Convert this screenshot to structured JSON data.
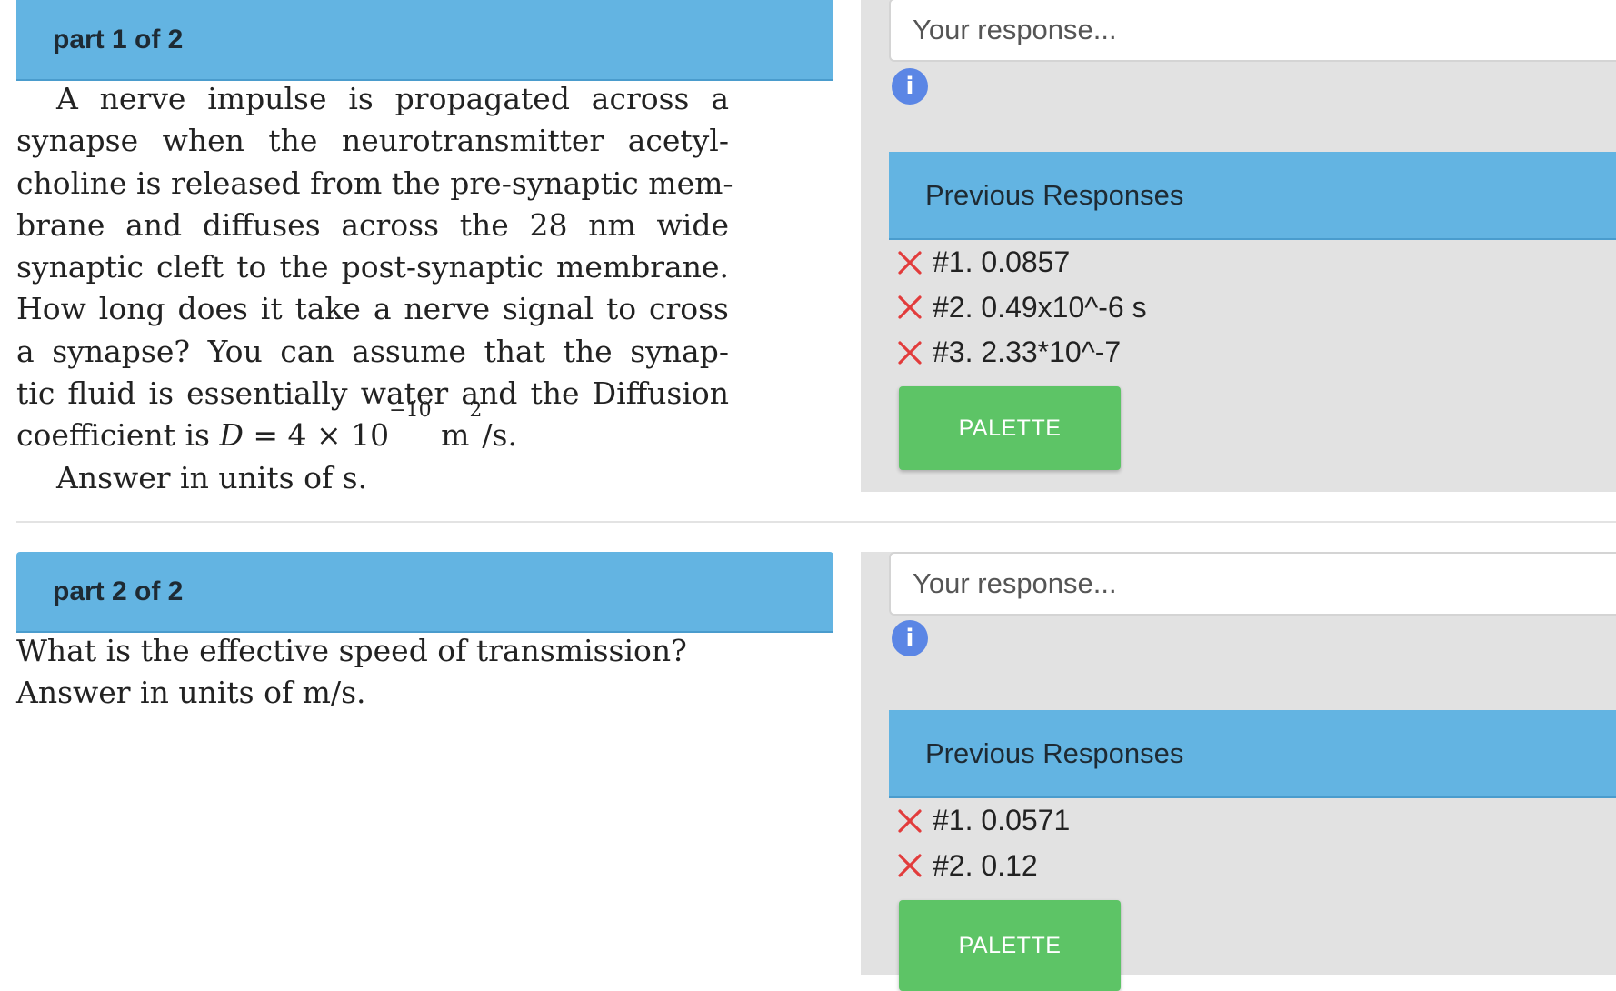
{
  "parts": [
    {
      "label": "part 1 of 2",
      "question": {
        "line1": "A nerve impulse is propagated across a",
        "line2": "synapse when the neurotransmitter acetyl-",
        "line3": "choline is released from the pre-synaptic mem-",
        "line4": "brane and diffuses across the 28 nm wide",
        "line5": "synaptic cleft to the post-synaptic membrane.",
        "line6": "How long does it take a nerve signal to cross",
        "line7": "a synapse? You can assume that the synap-",
        "line8": "tic fluid is essentially water and the Diffusion",
        "line9_a": "coefficient is ",
        "line9_var": "D",
        "line9_b": " = 4 × 10",
        "line9_exp": "−10",
        "line9_c": " m",
        "line9_exp2": "2",
        "line9_d": "/s.",
        "answer_units": "Answer in units of  s."
      },
      "response_placeholder": "Your response...",
      "info_icon": "i",
      "previous_responses_title": "Previous Responses",
      "previous_responses": [
        {
          "text": "#1. 0.0857",
          "status": "wrong"
        },
        {
          "text": "#2. 0.49x10^-6 s",
          "status": "wrong"
        },
        {
          "text": "#3. 2.33*10^-7",
          "status": "wrong"
        }
      ],
      "palette_label": "PALETTE"
    },
    {
      "label": "part 2 of 2",
      "question": {
        "line1": "What is the effective speed of transmission?",
        "answer_units": "Answer in units of  m/s."
      },
      "response_placeholder": "Your response...",
      "info_icon": "i",
      "previous_responses_title": "Previous Responses",
      "previous_responses": [
        {
          "text": "#1. 0.0571",
          "status": "wrong"
        },
        {
          "text": "#2. 0.12",
          "status": "wrong"
        }
      ],
      "palette_label": "PALETTE"
    }
  ],
  "colors": {
    "header_blue": "#63b4e2",
    "panel_gray": "#e2e2e2",
    "palette_green": "#5dc466",
    "wrong_red": "#e23c3c",
    "info_blue": "#5b86e5"
  },
  "icons": {
    "wrong": "close-icon",
    "info": "info-icon"
  }
}
